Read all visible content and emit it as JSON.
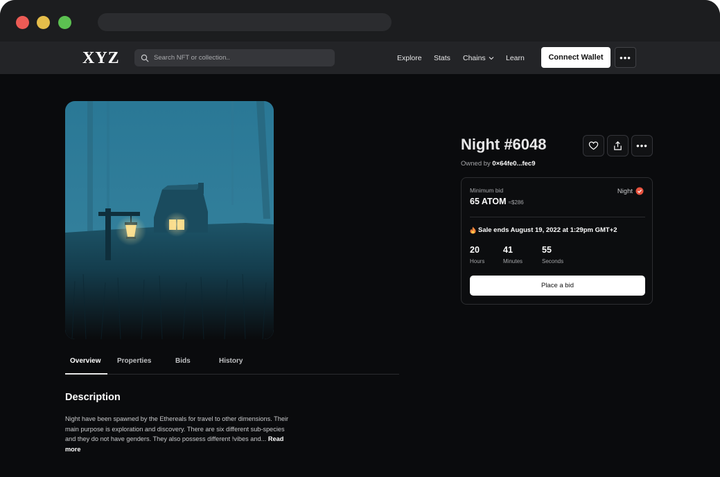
{
  "browser": {
    "controls": [
      "close",
      "minimize",
      "maximize"
    ]
  },
  "navbar": {
    "logo": "XYZ",
    "search_placeholder": "Search NFT or collection..",
    "links": {
      "explore": "Explore",
      "stats": "Stats",
      "chains": "Chains",
      "learn": "Learn"
    },
    "connect_wallet": "Connect Wallet",
    "more_icon": "more-horizontal-icon"
  },
  "nft": {
    "title": "Night #6048",
    "owned_by_label": "Owned by",
    "owner": "0×64fe0...fec9"
  },
  "bid_card": {
    "min_bid_label": "Minimum bid",
    "min_bid_value": "65 ATOM",
    "min_bid_usd": "≈$286",
    "chain_label": "Night",
    "sale_ends": "Sale ends August 19, 2022 at 1:29pm GMT+2",
    "countdown": {
      "hours": "20",
      "hours_label": "Hours",
      "minutes": "41",
      "minutes_label": "Minutes",
      "seconds": "55",
      "seconds_label": "Seconds"
    },
    "place_bid": "Place a bid"
  },
  "tabs": {
    "overview": "Overview",
    "properties": "Properties",
    "bids": "Bids",
    "history": "History"
  },
  "description": {
    "title": "Description",
    "text": "Night have been spawned by the Ethereals for travel to other dimensions. Their main purpose is exploration and discovery. There are six different sub-species and they do not have genders. They also possess different !vibes and... ",
    "read_more": "Read more"
  },
  "colors": {
    "background": "#0a0b0d",
    "navbar": "#232427",
    "accent_verified": "#e8533f",
    "artwork_sky": "#2c7d9a"
  }
}
